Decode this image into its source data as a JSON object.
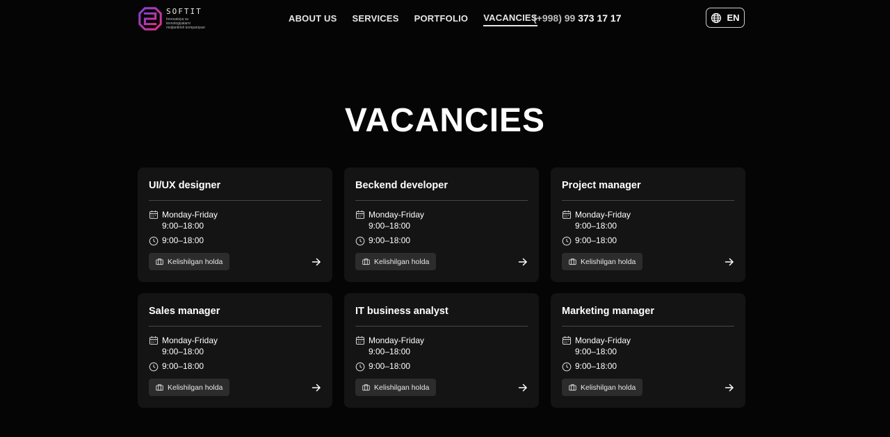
{
  "header": {
    "logo_name": "SOFTIT",
    "logo_tagline": "Innovatsiya va texnologiyalarni rivojlantirish kompaniyasi",
    "nav": [
      {
        "label": "ABOUT US"
      },
      {
        "label": "SERVICES"
      },
      {
        "label": "PORTFOLIO"
      },
      {
        "label": "VACANCIES",
        "active": true
      }
    ],
    "phone_prefix": "(+998) 99 ",
    "phone_main": "373 17 17",
    "language": "EN"
  },
  "page": {
    "title": "VACANCIES"
  },
  "vacancies": [
    {
      "title": "UI/UX designer",
      "days": "Monday-Friday",
      "hours": "9:00–18:00",
      "time": "9:00–18:00",
      "salary": "Kelishilgan holda"
    },
    {
      "title": "Beckend developer",
      "days": "Monday-Friday",
      "hours": "9:00–18:00",
      "time": "9:00–18:00",
      "salary": "Kelishilgan holda"
    },
    {
      "title": "Project manager",
      "days": "Monday-Friday",
      "hours": "9:00–18:00",
      "time": "9:00–18:00",
      "salary": "Kelishilgan holda"
    },
    {
      "title": "Sales manager",
      "days": "Monday-Friday",
      "hours": "9:00–18:00",
      "time": "9:00–18:00",
      "salary": "Kelishilgan holda"
    },
    {
      "title": "IT business analyst",
      "days": "Monday-Friday",
      "hours": "9:00–18:00",
      "time": "9:00–18:00",
      "salary": "Kelishilgan holda"
    },
    {
      "title": "Marketing manager",
      "days": "Monday-Friday",
      "hours": "9:00–18:00",
      "time": "9:00–18:00",
      "salary": "Kelishilgan holda"
    }
  ],
  "icons": {
    "logo": "softit-logo-icon",
    "language": "globe-icon",
    "days": "calendar-icon",
    "time": "clock-icon",
    "salary": "briefcase-icon",
    "open": "arrow-right-icon"
  },
  "colors": {
    "background": "#050505",
    "card": "#141414",
    "badge": "#2c2c2c",
    "logo_pink": "#e0308a",
    "logo_purple": "#8a3fd1"
  }
}
